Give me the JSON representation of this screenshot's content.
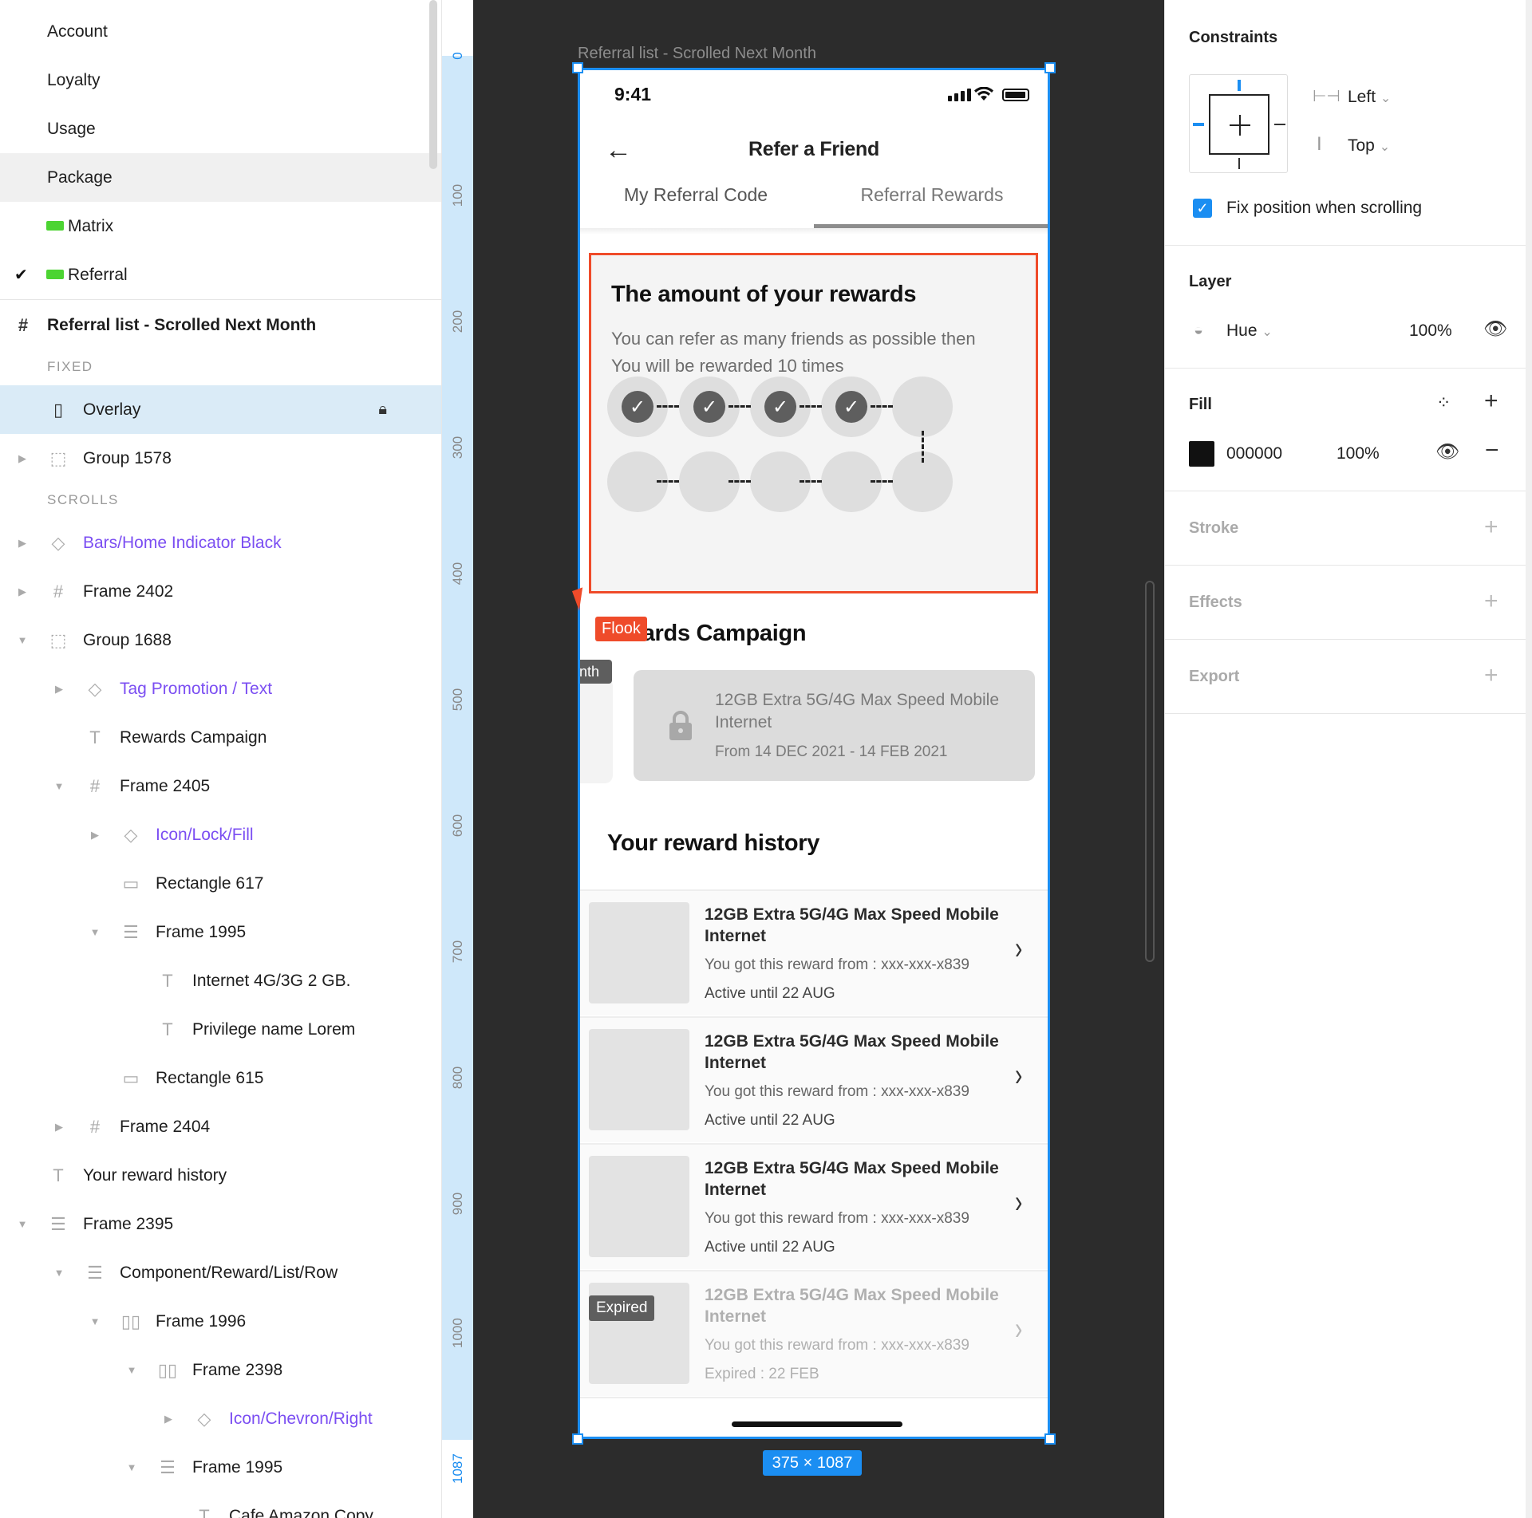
{
  "layers": {
    "pages": [
      "Account",
      "Loyalty",
      "Usage",
      "Package",
      "Matrix",
      "Referral"
    ],
    "frame_name": "Referral list - Scrolled Next Month",
    "section_fixed": "FIXED",
    "section_scrolls": "SCROLLS",
    "items": [
      {
        "label": "Overlay",
        "icon": "rect"
      },
      {
        "label": "Group 1578",
        "icon": "group"
      },
      {
        "label": "Bars/Home Indicator Black",
        "icon": "component"
      },
      {
        "label": "Frame 2402",
        "icon": "frame"
      },
      {
        "label": "Group 1688",
        "icon": "group"
      },
      {
        "label": "Tag Promotion / Text",
        "icon": "component"
      },
      {
        "label": "Rewards Campaign",
        "icon": "text"
      },
      {
        "label": "Frame 2405",
        "icon": "frame"
      },
      {
        "label": "Icon/Lock/Fill",
        "icon": "component"
      },
      {
        "label": "Rectangle 617",
        "icon": "rect"
      },
      {
        "label": "Frame 1995",
        "icon": "stack"
      },
      {
        "label": "Internet 4G/3G 2 GB.",
        "icon": "text"
      },
      {
        "label": "Privilege name Lorem",
        "icon": "text"
      },
      {
        "label": "Rectangle 615",
        "icon": "rect"
      },
      {
        "label": "Frame 2404",
        "icon": "frame"
      },
      {
        "label": "Your reward history",
        "icon": "text"
      },
      {
        "label": "Frame 2395",
        "icon": "stack"
      },
      {
        "label": "Component/Reward/List/Row",
        "icon": "stack"
      },
      {
        "label": "Frame 1996",
        "icon": "columns"
      },
      {
        "label": "Frame 2398",
        "icon": "columns"
      },
      {
        "label": "Icon/Chevron/Right",
        "icon": "component"
      },
      {
        "label": "Frame 1995",
        "icon": "stack"
      },
      {
        "label": "Cafe Amazon Copy",
        "icon": "text"
      }
    ]
  },
  "ruler": {
    "ticks": [
      "0",
      "100",
      "200",
      "300",
      "400",
      "500",
      "600",
      "700",
      "800",
      "900",
      "1000",
      "1087"
    ]
  },
  "canvas": {
    "frame_title": "Referral list - Scrolled Next Month",
    "size_label": "375 × 1087",
    "cursor_label": "Flook"
  },
  "phone": {
    "time": "9:41",
    "nav_title": "Refer a Friend",
    "tabs": [
      "My Referral Code",
      "Referral Rewards"
    ],
    "active_tab": 1,
    "rewards": {
      "title": "The amount of your rewards",
      "desc_line1": "You can refer as many friends as possible then",
      "desc_line2": "You will be rewarded 10 times",
      "completed": 4,
      "total": 10
    },
    "campaign": {
      "title": "Rewards Campaign",
      "month_tag": "nth",
      "card_name": "12GB Extra 5G/4G Max Speed Mobile Internet",
      "card_date": "From 14 DEC 2021 - 14 FEB 2021"
    },
    "history": {
      "title": "Your reward history",
      "rows": [
        {
          "name": "12GB Extra 5G/4G Max Speed Mobile Internet",
          "from": "You got this reward from : xxx-xxx-x839",
          "status": "Active until 22 AUG",
          "expired": false
        },
        {
          "name": "12GB Extra 5G/4G Max Speed Mobile Internet",
          "from": "You got this reward from : xxx-xxx-x839",
          "status": "Active until 22 AUG",
          "expired": false
        },
        {
          "name": "12GB Extra 5G/4G Max Speed Mobile Internet",
          "from": "You got this reward from : xxx-xxx-x839",
          "status": "Active until 22 AUG",
          "expired": false
        },
        {
          "name": "12GB Extra 5G/4G Max Speed Mobile Internet",
          "from": "You got this reward from : xxx-xxx-x839",
          "status": "Expired : 22 FEB",
          "expired": true,
          "tag": "Expired"
        }
      ]
    }
  },
  "props": {
    "constraints_title": "Constraints",
    "h_constraint": "Left",
    "v_constraint": "Top",
    "fix_label": "Fix position when scrolling",
    "layer_title": "Layer",
    "blend": "Hue",
    "layer_opacity": "100%",
    "fill_title": "Fill",
    "fill_hex": "000000",
    "fill_opacity": "100%",
    "stroke_title": "Stroke",
    "effects_title": "Effects",
    "export_title": "Export"
  },
  "colors": {
    "selection": "#1b8ef2",
    "accent": "#ef4b2a",
    "component": "#7b4ef2",
    "canvas": "#2c2c2c"
  }
}
